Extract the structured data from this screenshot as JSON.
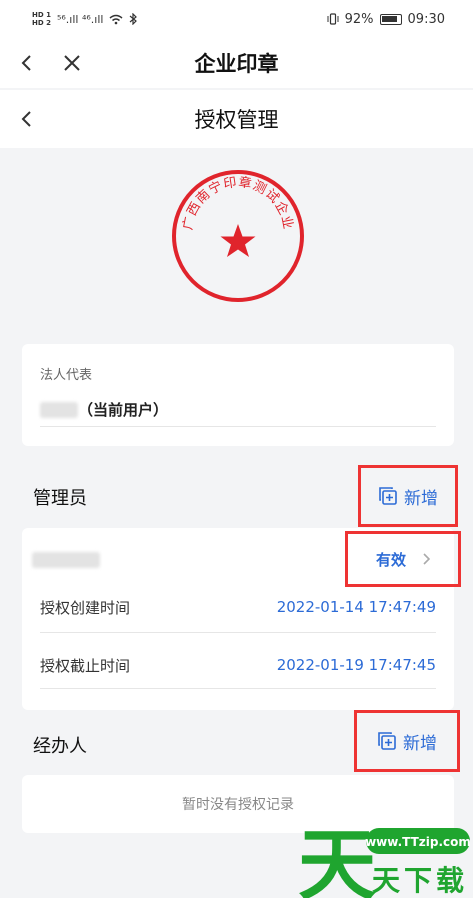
{
  "status_bar": {
    "hd1": "HD 1",
    "hd2": "HD 2",
    "signal": "⁵⁶.ıll ⁴⁶.ıll",
    "battery_pct": "92%",
    "time": "09:30"
  },
  "nav_top": {
    "title": "企业印章"
  },
  "nav_sub": {
    "title": "授权管理"
  },
  "seal": {
    "text": "广西南宁印章测试企业",
    "color": "#e0242c"
  },
  "legal": {
    "label": "法人代表",
    "name_suffix": "（当前用户）"
  },
  "admin": {
    "title": "管理员",
    "add_label": "新增",
    "status_label": "有效",
    "rows": [
      {
        "key": "授权创建时间",
        "value": "2022-01-14 17:47:49"
      },
      {
        "key": "授权截止时间",
        "value": "2022-01-19 17:47:45"
      }
    ]
  },
  "handler": {
    "title": "经办人",
    "add_label": "新增",
    "empty_text": "暂时没有授权记录"
  },
  "watermark": {
    "site": "www.TTzip.com",
    "brand": "天下载",
    "big_char": "天"
  },
  "colors": {
    "accent": "#2c6bd6",
    "highlight_box": "#e33",
    "seal_red": "#e0242c",
    "watermark_green": "#1fa52f"
  }
}
